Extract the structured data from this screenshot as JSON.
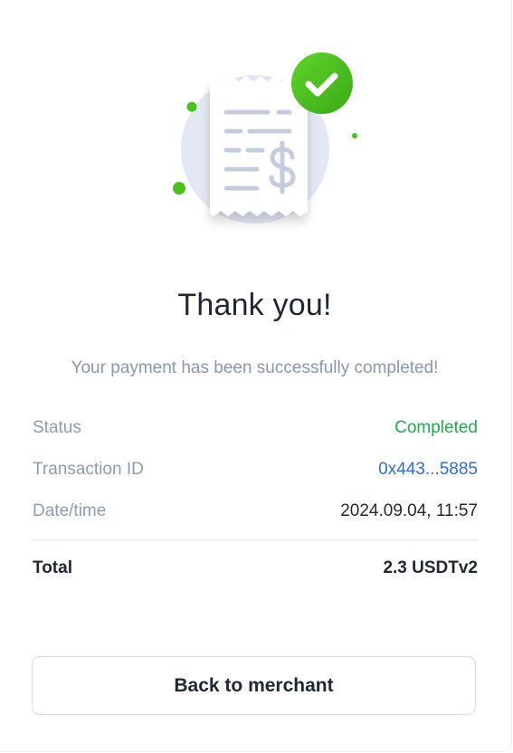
{
  "illustration": {
    "icons": [
      "receipt-icon",
      "dollar-sign-icon",
      "check-icon"
    ],
    "accent_color": "#4cc01e",
    "receipt_circle_color": "#e4e8f4"
  },
  "header": {
    "title": "Thank you!",
    "subtitle": "Your payment has been successfully completed!"
  },
  "details": {
    "status_label": "Status",
    "status_value": "Completed",
    "status_color": "#26a94a",
    "transaction_label": "Transaction ID",
    "transaction_value": "0x443...5885",
    "transaction_color": "#2e6dd8",
    "datetime_label": "Date/time",
    "datetime_value": "2024.09.04, 11:57",
    "total_label": "Total",
    "total_value": "2.3 USDTv2"
  },
  "actions": {
    "back_label": "Back to merchant"
  }
}
